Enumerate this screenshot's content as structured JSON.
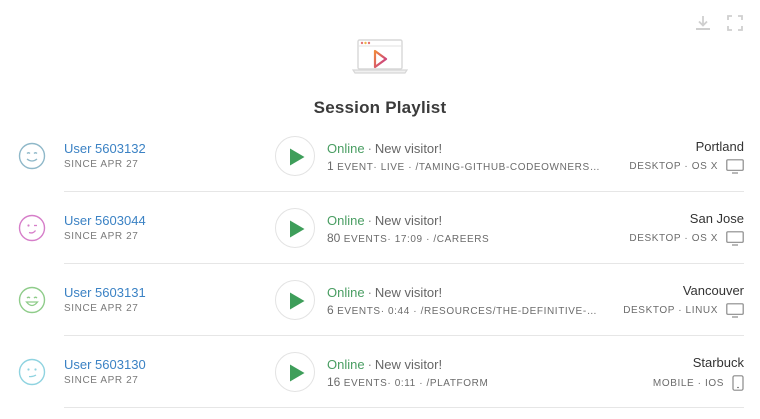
{
  "header": {
    "title": "Session Playlist",
    "download_icon": "download-icon",
    "fullscreen_icon": "fullscreen-icon",
    "hero_icon": "laptop-play-icon"
  },
  "colors": {
    "link": "#3b82c4",
    "online": "#4a9e63",
    "play": "#3e9e5a",
    "muted": "#7a7a7a"
  },
  "sessions": [
    {
      "user": "User 5603132",
      "since": "SINCE APR 27",
      "avatar_color": "#8fb8c9",
      "avatar_mood": "smile",
      "status": "Online",
      "sep": "·",
      "visitor": "New visitor!",
      "event_count": "1",
      "event_label": "EVENT",
      "duration": "LIVE",
      "path": "/TAMING-GITHUB-CODEOWNERS-...",
      "city": "Portland",
      "device": "DESKTOP",
      "os": "OS X",
      "device_icon": "monitor-icon"
    },
    {
      "user": "User 5603044",
      "since": "SINCE APR 27",
      "avatar_color": "#d67ec9",
      "avatar_mood": "wink",
      "status": "Online",
      "sep": "·",
      "visitor": "New visitor!",
      "event_count": "80",
      "event_label": "EVENTS",
      "duration": "17:09",
      "path": "/CAREERS",
      "city": "San Jose",
      "device": "DESKTOP",
      "os": "OS X",
      "device_icon": "monitor-icon"
    },
    {
      "user": "User 5603131",
      "since": "SINCE APR 27",
      "avatar_color": "#8fcc8a",
      "avatar_mood": "laugh",
      "status": "Online",
      "sep": "·",
      "visitor": "New visitor!",
      "event_count": "6",
      "event_label": "EVENTS",
      "duration": "0:44",
      "path": "/RESOURCES/THE-DEFINITIVE-G...",
      "city": "Vancouver",
      "device": "DESKTOP",
      "os": "LINUX",
      "device_icon": "monitor-icon"
    },
    {
      "user": "User 5603130",
      "since": "SINCE APR 27",
      "avatar_color": "#8fd3e0",
      "avatar_mood": "smirk",
      "status": "Online",
      "sep": "·",
      "visitor": "New visitor!",
      "event_count": "16",
      "event_label": "EVENTS",
      "duration": "0:11",
      "path": "/PLATFORM",
      "city": "Starbuck",
      "device": "MOBILE",
      "os": "IOS",
      "device_icon": "phone-icon"
    }
  ]
}
